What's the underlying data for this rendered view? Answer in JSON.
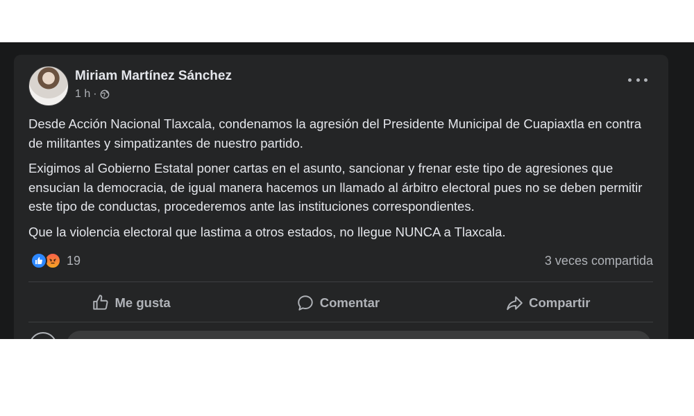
{
  "post": {
    "author": "Miriam Martínez Sánchez",
    "time": "1 h",
    "separator": "·",
    "paragraphs": [
      "Desde Acción Nacional Tlaxcala, condenamos la agresión del Presidente Municipal de Cuapiaxtla en contra de militantes y simpatizantes de nuestro partido.",
      "Exigimos al Gobierno Estatal poner cartas en el asunto, sancionar y frenar este tipo de agresiones que ensucian la democracia, de igual manera hacemos un llamado al árbitro electoral pues no se deben permitir este tipo de conductas, procederemos ante las instituciones correspondientes.",
      "Que la violencia electoral que lastima a otros estados, no llegue NUNCA a Tlaxcala."
    ],
    "reaction_count": "19",
    "shares": "3 veces compartida"
  },
  "actions": {
    "like": "Me gusta",
    "comment": "Comentar",
    "share": "Compartir"
  },
  "colors": {
    "page_bg": "#18191a",
    "card_bg": "#242526",
    "primary_text": "#e4e6eb",
    "secondary_text": "#b0b3b8",
    "like_blue": "#2d88ff",
    "angry_orange": "#f5a623"
  },
  "icons": {
    "privacy": "globe-icon",
    "menu": "more-options-icon",
    "like": "thumbs-up-icon",
    "comment": "comment-bubble-icon",
    "share": "share-arrow-icon"
  }
}
